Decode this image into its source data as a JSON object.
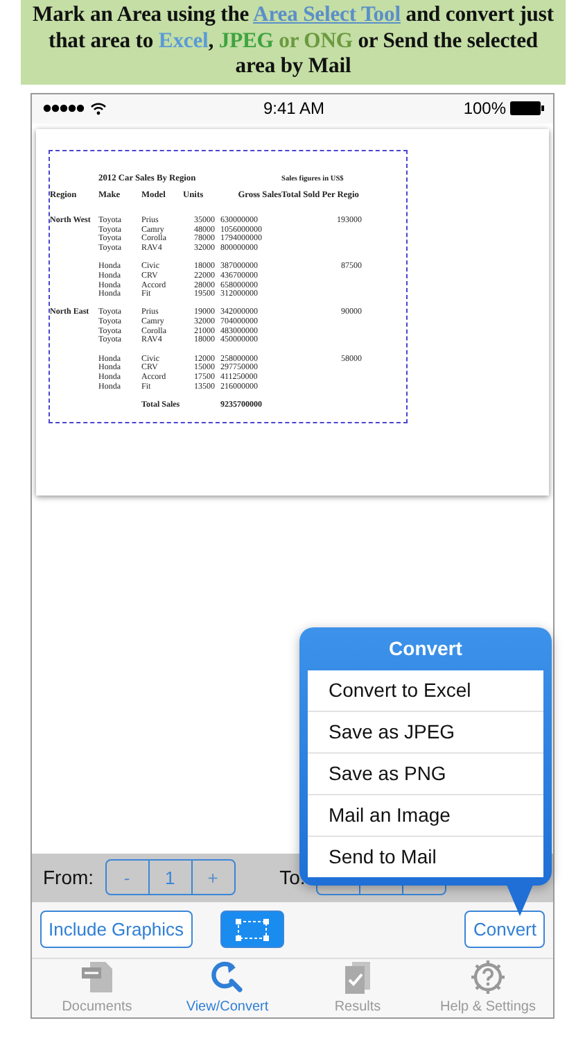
{
  "banner": {
    "segments": [
      {
        "text": "Mark an Area using the ",
        "kind": "plain"
      },
      {
        "text": "Area Select Tool",
        "kind": "link"
      },
      {
        "text": " and convert just that area to ",
        "kind": "plain"
      },
      {
        "text": "Excel",
        "kind": "colored",
        "color": "#5b9bd5"
      },
      {
        "text": ", ",
        "kind": "plain"
      },
      {
        "text": "JPEG",
        "kind": "colored",
        "color": "#3fa33f"
      },
      {
        "text": " or ONG",
        "kind": "colored",
        "color": "#6b9a3f"
      },
      {
        "text": " or Send the selected area by Mail",
        "kind": "plain"
      }
    ]
  },
  "status_bar": {
    "time": "9:41 AM",
    "battery": "100%"
  },
  "document": {
    "title": "2012 Car Sales By Region",
    "note": "Sales figures in US$",
    "columns": [
      "Region",
      "Make",
      "Model",
      "Units",
      "Gross Sales",
      "Total Sold Per Regio"
    ],
    "groups": [
      {
        "region": "North West",
        "total": "193000",
        "rows": [
          {
            "make": "Toyota",
            "model": "Prius",
            "units": "35000",
            "gross": "630000000"
          },
          {
            "make": "Toyota",
            "model": "Camry",
            "units": "48000",
            "gross": "1056000000"
          },
          {
            "make": "Toyota",
            "model": "Corolla",
            "units": "78000",
            "gross": "1794000000"
          },
          {
            "make": "Toyota",
            "model": "RAV4",
            "units": "32000",
            "gross": "800000000"
          }
        ]
      },
      {
        "total": "87500",
        "rows": [
          {
            "make": "Honda",
            "model": "Civic",
            "units": "18000",
            "gross": "387000000"
          },
          {
            "make": "Honda",
            "model": "CRV",
            "units": "22000",
            "gross": "436700000"
          },
          {
            "make": "Honda",
            "model": "Accord",
            "units": "28000",
            "gross": "658000000"
          },
          {
            "make": "Honda",
            "model": "Fit",
            "units": "19500",
            "gross": "312000000"
          }
        ]
      },
      {
        "region": "North East",
        "total": "90000",
        "rows": [
          {
            "make": "Toyota",
            "model": "Prius",
            "units": "19000",
            "gross": "342000000"
          },
          {
            "make": "Toyota",
            "model": "Camry",
            "units": "32000",
            "gross": "704000000"
          },
          {
            "make": "Toyota",
            "model": "Corolla",
            "units": "21000",
            "gross": "483000000"
          },
          {
            "make": "Toyota",
            "model": "RAV4",
            "units": "18000",
            "gross": "450000000"
          }
        ]
      },
      {
        "total": "58000",
        "rows": [
          {
            "make": "Honda",
            "model": "Civic",
            "units": "12000",
            "gross": "258000000"
          },
          {
            "make": "Honda",
            "model": "CRV",
            "units": "15000",
            "gross": "297750000"
          },
          {
            "make": "Honda",
            "model": "Accord",
            "units": "17500",
            "gross": "411250000"
          },
          {
            "make": "Honda",
            "model": "Fit",
            "units": "13500",
            "gross": "216000000"
          }
        ]
      }
    ],
    "total_label": "Total Sales",
    "total_value": "9235700000"
  },
  "page_range": {
    "from_label": "From:",
    "decrement": "-",
    "page": "1",
    "increment": "+",
    "to_label": "To:"
  },
  "toolbar": {
    "include_graphics": "Include Graphics",
    "area_select_selected": true,
    "convert": "Convert"
  },
  "popover": {
    "title": "Convert",
    "items": [
      "Convert to Excel",
      "Save as JPEG",
      "Save as PNG",
      "Mail an Image",
      "Send to Mail"
    ]
  },
  "tabs": [
    {
      "label": "Documents",
      "kind": "pdf",
      "selected": false
    },
    {
      "label": "View/Convert",
      "kind": "convert",
      "selected": true
    },
    {
      "label": "Results",
      "kind": "results",
      "selected": false
    },
    {
      "label": "Help & Settings",
      "kind": "help",
      "selected": false
    }
  ]
}
